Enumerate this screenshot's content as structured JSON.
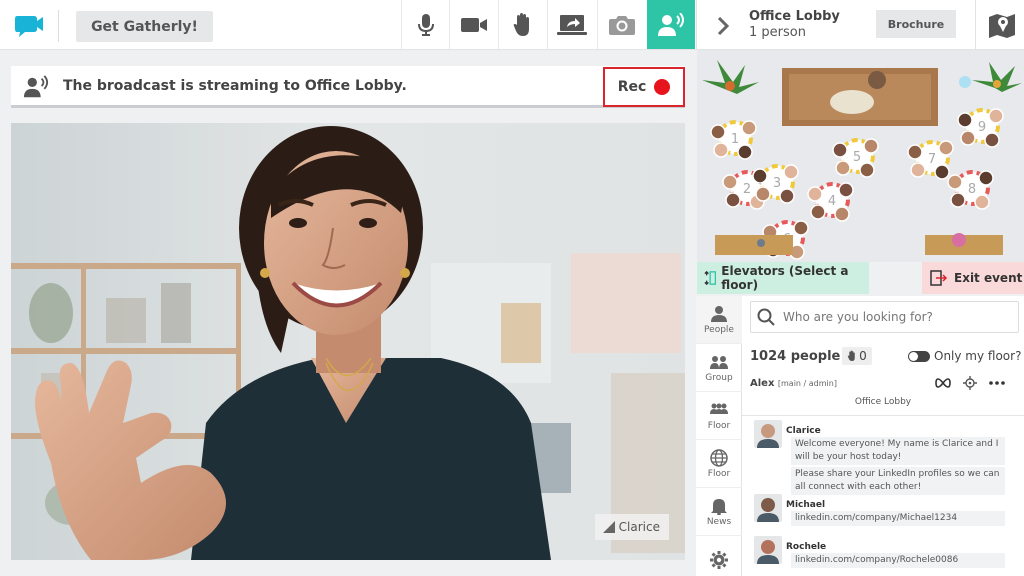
{
  "toolbar": {
    "get_label": "Get Gatherly!",
    "tools": [
      {
        "name": "microphone-icon",
        "active": false
      },
      {
        "name": "camera-icon",
        "active": false
      },
      {
        "name": "raise-hand-icon",
        "active": false
      },
      {
        "name": "screen-share-icon",
        "active": false
      },
      {
        "name": "photo-icon",
        "active": false
      },
      {
        "name": "broadcast-icon",
        "active": true
      }
    ],
    "accent": "#2ec4a6"
  },
  "broadcast": {
    "message": "The broadcast is streaming to Office Lobby.",
    "rec_label": "Rec",
    "rec_color": "#e8141d"
  },
  "video": {
    "participant_name": "Clarice"
  },
  "room": {
    "title": "Office Lobby",
    "count": "1 person",
    "brochure_label": "Brochure"
  },
  "floor": {
    "elevators_label": "Elevators (Select a floor)",
    "exit_label": "Exit event",
    "table_numbers": [
      "1",
      "2",
      "3",
      "4",
      "5",
      "6",
      "7",
      "8",
      "9"
    ]
  },
  "nav": [
    {
      "label": "People",
      "icon": "person-icon",
      "active": true
    },
    {
      "label": "Group",
      "icon": "group-icon",
      "active": false
    },
    {
      "label": "Floor",
      "icon": "floor-people-icon",
      "active": false
    },
    {
      "label": "Floor",
      "icon": "globe-icon",
      "active": false
    },
    {
      "label": "News",
      "icon": "bell-icon",
      "active": false
    },
    {
      "label": "",
      "icon": "settings-icon",
      "active": false
    }
  ],
  "people": {
    "search_placeholder": "Who are you looking for?",
    "count_label": "1024 people",
    "hands_raised": "0",
    "only_floor_label": "Only my floor?",
    "me_name": "Alex",
    "me_role": "[main / admin]",
    "me_location": "Office Lobby"
  },
  "chat": [
    {
      "sender": "Clarice",
      "messages": [
        "Welcome everyone! My name is Clarice and I will be your host today!",
        "Please share your LinkedIn profiles so we can all connect with each other!"
      ]
    },
    {
      "sender": "Michael",
      "messages": [
        "linkedin.com/company/Michael1234"
      ]
    },
    {
      "sender": "Rochele",
      "messages": [
        "linkedin.com/company/Rochele0086"
      ]
    }
  ]
}
